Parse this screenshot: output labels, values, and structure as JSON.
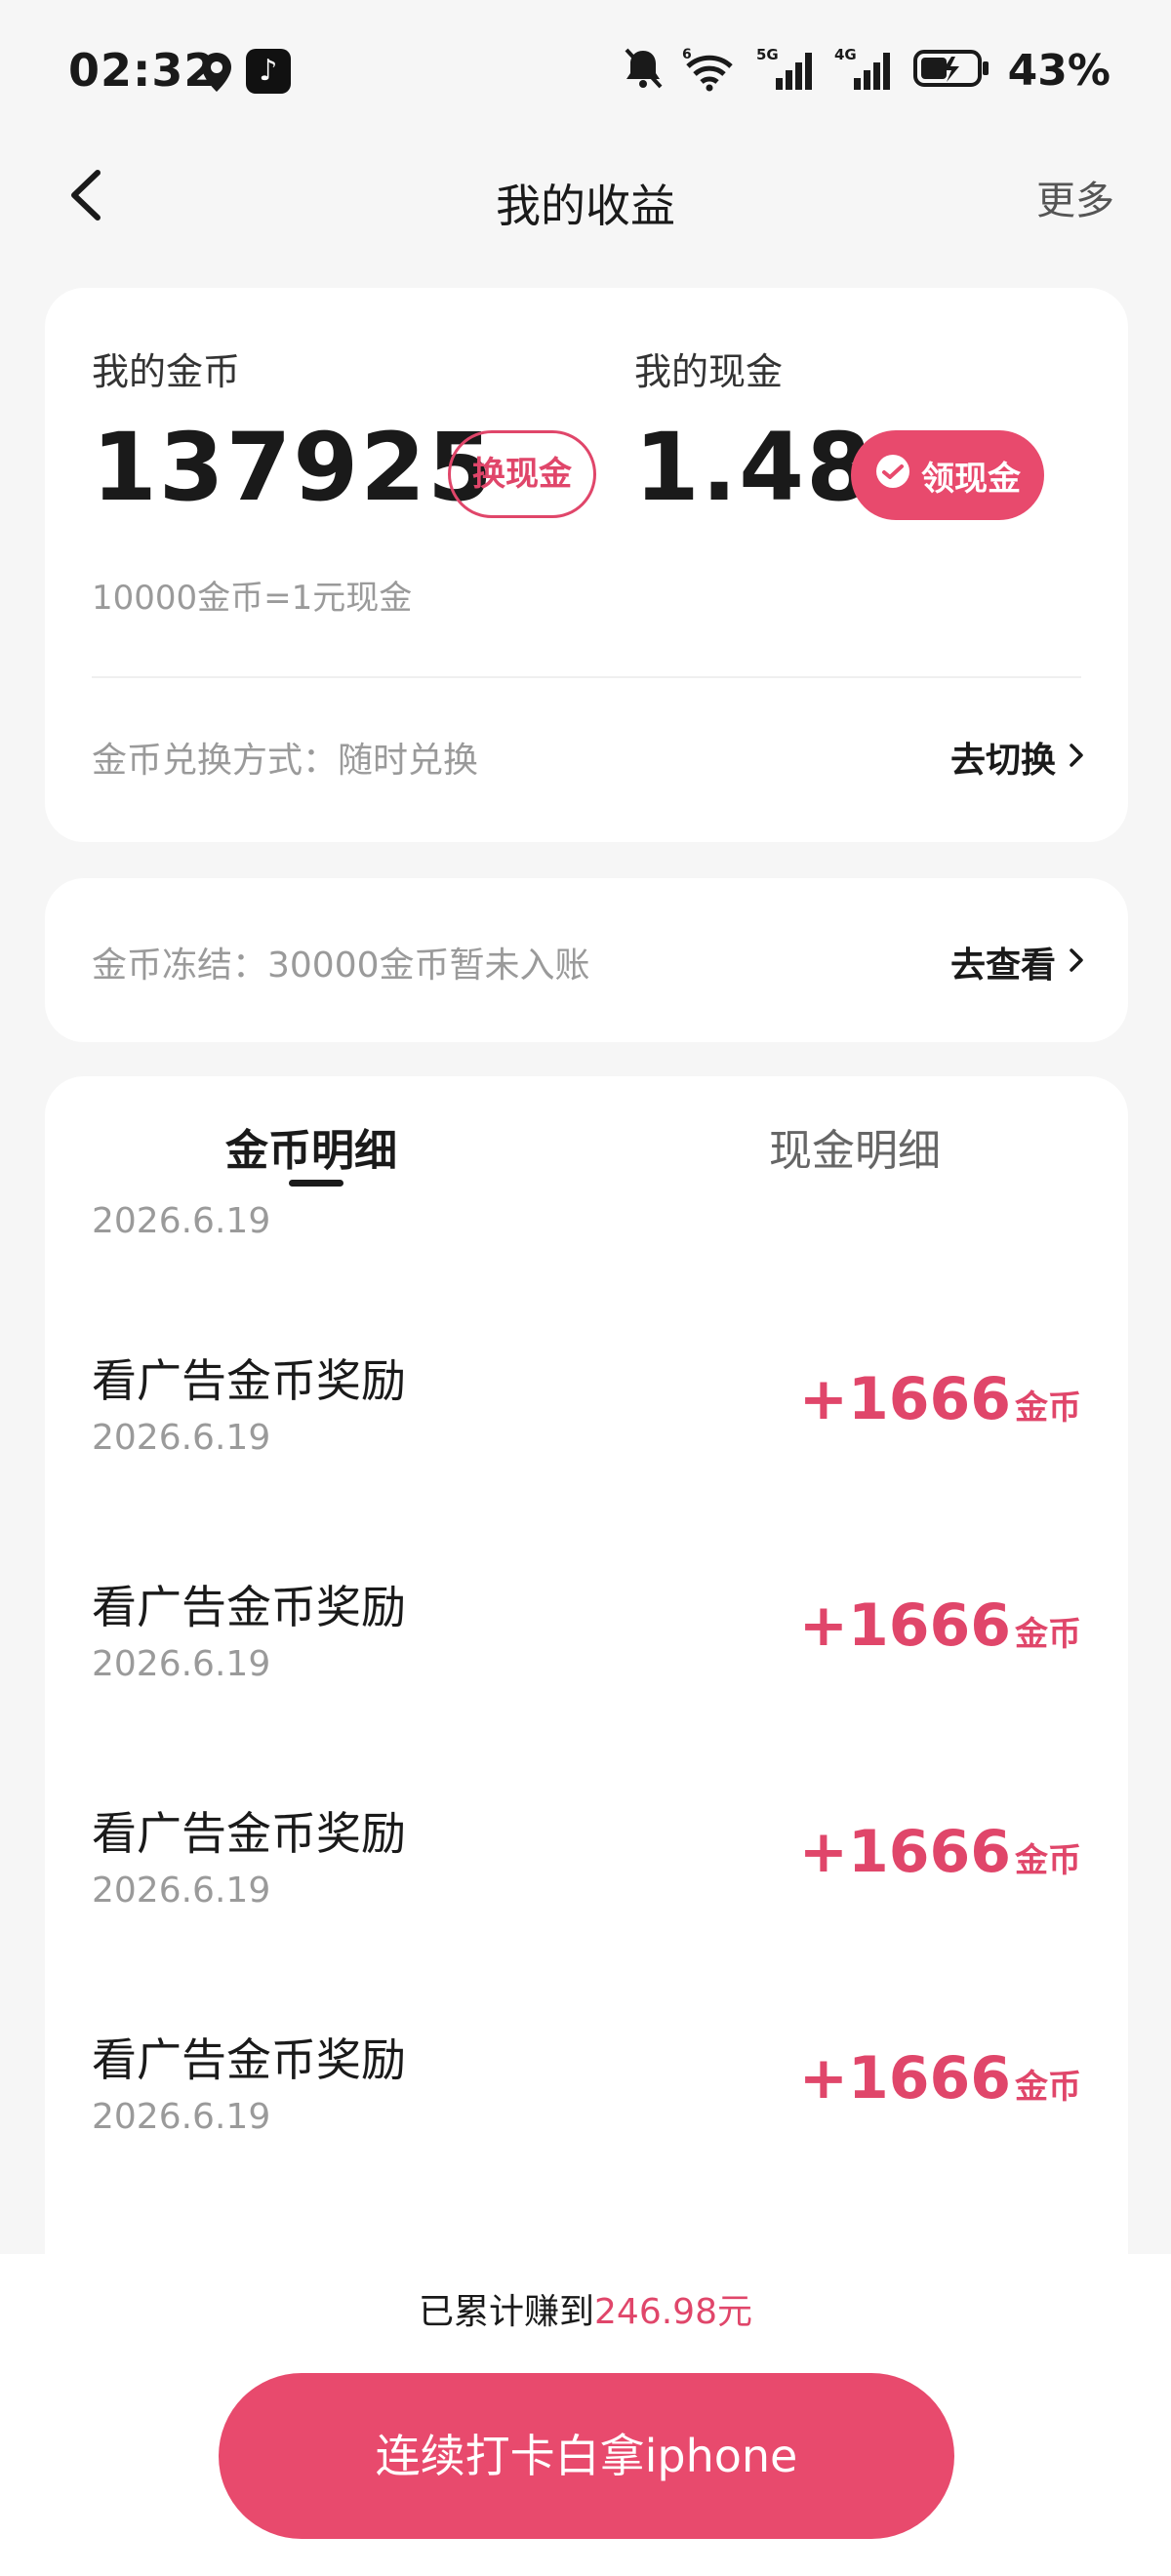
{
  "status_bar": {
    "time": "02:32",
    "battery_percent": "43%",
    "network_5g": "5G",
    "network_4g": "4G",
    "wifi_badge": "6",
    "icons": [
      "location-icon",
      "tiktok-icon",
      "mute-bell-icon",
      "wifi-icon",
      "signal-5g-icon",
      "signal-4g-icon",
      "battery-charging-icon"
    ]
  },
  "nav": {
    "title": "我的收益",
    "more": "更多"
  },
  "balance": {
    "coins_label": "我的金币",
    "coins_value": "137925",
    "exchange_button": "换现金",
    "cash_label": "我的现金",
    "cash_value": "1.48",
    "withdraw_button": "领现金",
    "rate_text": "10000金币=1元现金",
    "exchange_mode_text": "金币兑换方式：随时兑换",
    "switch_link": "去切换"
  },
  "frozen": {
    "text": "金币冻结：30000金币暂未入账",
    "view_link": "去查看"
  },
  "detail": {
    "tabs": [
      {
        "label": "金币明细",
        "active": true
      },
      {
        "label": "现金明细",
        "active": false
      }
    ],
    "first_date": "2026.6.19",
    "transactions": [
      {
        "title": "看广告金币奖励",
        "date": "2026.6.19",
        "amount": "+1666",
        "unit": "金币"
      },
      {
        "title": "看广告金币奖励",
        "date": "2026.6.19",
        "amount": "+1666",
        "unit": "金币"
      },
      {
        "title": "看广告金币奖励",
        "date": "2026.6.19",
        "amount": "+1666",
        "unit": "金币"
      },
      {
        "title": "看广告金币奖励",
        "date": "2026.6.19",
        "amount": "+1666",
        "unit": "金币"
      }
    ]
  },
  "footer": {
    "earned_prefix": "已累计赚到",
    "earned_amount": "246.98元",
    "cta_label": "连续打卡白拿iphone"
  },
  "colors": {
    "accent": "#e84a6d",
    "accent_text": "#e0466a",
    "background": "#f6f6f6"
  }
}
